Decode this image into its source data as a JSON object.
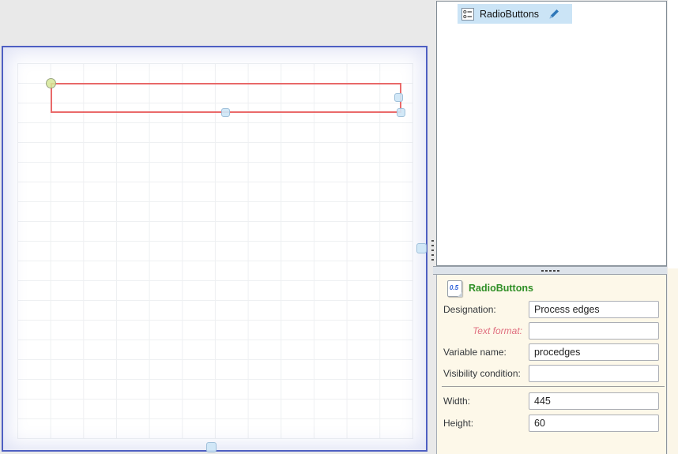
{
  "tree_panel": {
    "items": [
      {
        "label": "RadioButtons",
        "icon": "radiobuttons-icon",
        "selected": true,
        "edit_icon": "edit-pencil-icon"
      }
    ]
  },
  "properties_panel": {
    "header": {
      "icon": "number-format-icon",
      "icon_label": "0.5",
      "title": "RadioButtons"
    },
    "fields": [
      {
        "label": "Designation:",
        "value": "Process edges"
      },
      {
        "label": "Text format:",
        "value": ""
      },
      {
        "label": "Variable name:",
        "value": "procedges"
      },
      {
        "label": "Visibility condition:",
        "value": ""
      },
      {
        "label": "Width:",
        "value": "445"
      },
      {
        "label": "Height:",
        "value": "60"
      }
    ]
  },
  "canvas": {
    "selected_control": {
      "type": "RadioButtons",
      "width": "445",
      "height": "60"
    }
  },
  "colors": {
    "selection_outline": "#e85454",
    "resize_handle_fill": "#cde5f6",
    "rotate_handle_fill": "#d6e898",
    "tree_selection_bg": "#cbe4f6",
    "properties_bg": "#fdf8e9",
    "header_title_green": "#2f8f26",
    "format_label_pink": "#e07080",
    "canvas_border_blue": "#4e5fc2"
  },
  "icons": [
    "radiobuttons-icon",
    "edit-pencil-icon",
    "number-format-icon",
    "resize-handle",
    "rotate-handle"
  ]
}
